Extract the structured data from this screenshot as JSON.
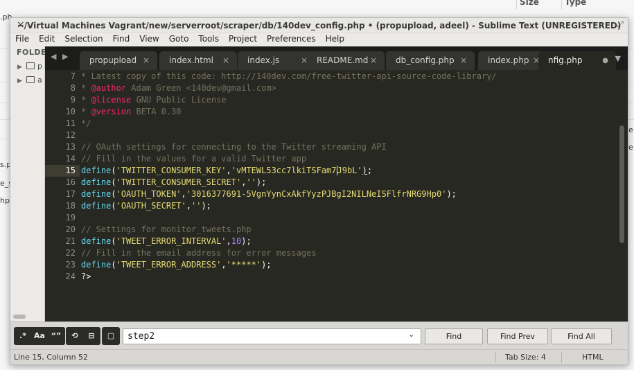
{
  "background": {
    "col_size": "Size",
    "col_type": "Type",
    "left_fragments": [
      "s.p",
      "e_s",
      "hp"
    ],
    "right_fragments": [
      "e",
      "e"
    ],
    "top_fragment": ".ph"
  },
  "window": {
    "close_glyph": "×",
    "title": "~/Virtual Machines Vagrant/new/serverroot/scraper/db/140dev_config.php • (propupload, adeel) - Sublime Text (UNREGISTERED)",
    "maximize_glyph": "⤢"
  },
  "menu": [
    "File",
    "Edit",
    "Selection",
    "Find",
    "View",
    "Goto",
    "Tools",
    "Project",
    "Preferences",
    "Help"
  ],
  "sidebar": {
    "header": "FOLDE",
    "items": [
      {
        "name": "p"
      },
      {
        "name": "a"
      }
    ]
  },
  "tabs": [
    {
      "label": "propupload",
      "close": "×"
    },
    {
      "label": "index.html",
      "close": "×"
    },
    {
      "label": "index.js",
      "close": "×"
    },
    {
      "label": "README.md",
      "close": "×"
    },
    {
      "label": "db_config.php",
      "close": "×"
    },
    {
      "label": "index.php",
      "close": "×"
    },
    {
      "label": "nfig.php",
      "close": "●",
      "active": true
    }
  ],
  "editor": {
    "current_line": 15,
    "line_numbers": [
      "7",
      "8",
      "9",
      "10",
      "11",
      "12",
      "13",
      "14",
      "15",
      "16",
      "17",
      "18",
      "19",
      "20",
      "21",
      "22",
      "23",
      "24"
    ],
    "lines": [
      [
        {
          "t": "* Latest copy of this code: http://140dev.com/free-twitter-api-source-code-library/",
          "c": "comment"
        }
      ],
      [
        {
          "t": "* ",
          "c": "comment"
        },
        {
          "t": "@author",
          "c": "at"
        },
        {
          "t": " Adam Green <140dev@gmail.com>",
          "c": "comment"
        }
      ],
      [
        {
          "t": "* ",
          "c": "comment"
        },
        {
          "t": "@license",
          "c": "at"
        },
        {
          "t": " GNU Public License",
          "c": "comment"
        }
      ],
      [
        {
          "t": "* ",
          "c": "comment"
        },
        {
          "t": "@version",
          "c": "at"
        },
        {
          "t": " BETA 0.30",
          "c": "comment"
        }
      ],
      [
        {
          "t": "*/",
          "c": "comment"
        }
      ],
      [],
      [
        {
          "t": "// OAuth settings for connecting to the Twitter streaming API",
          "c": "comment"
        }
      ],
      [
        {
          "t": "// Fill in the values for a valid Twitter app",
          "c": "comment"
        }
      ],
      [
        {
          "t": "define",
          "c": "func"
        },
        {
          "t": "(",
          "c": "plain"
        },
        {
          "t": "'TWITTER_CONSUMER_KEY'",
          "c": "str"
        },
        {
          "t": ",",
          "c": "plain"
        },
        {
          "t": "'vMTEWL53cc7lkiTSFam7",
          "c": "str"
        },
        {
          "t": "",
          "c": "cursor"
        },
        {
          "t": "J9bL'",
          "c": "str"
        },
        {
          "t": ")",
          "c": "plain underline"
        },
        {
          "t": ";",
          "c": "plain"
        }
      ],
      [
        {
          "t": "define",
          "c": "func"
        },
        {
          "t": "(",
          "c": "plain"
        },
        {
          "t": "'TWITTER_CONSUMER_SECRET'",
          "c": "str"
        },
        {
          "t": ",",
          "c": "plain"
        },
        {
          "t": "''",
          "c": "str"
        },
        {
          "t": ");",
          "c": "plain"
        }
      ],
      [
        {
          "t": "define",
          "c": "func"
        },
        {
          "t": "(",
          "c": "plain"
        },
        {
          "t": "'OAUTH_TOKEN'",
          "c": "str"
        },
        {
          "t": ",",
          "c": "plain"
        },
        {
          "t": "'3016377691-5VgnYynCxAkfYyzPJBgI2NILNeISFlfrNRG9Hp0'",
          "c": "str"
        },
        {
          "t": ");",
          "c": "plain"
        }
      ],
      [
        {
          "t": "define",
          "c": "func"
        },
        {
          "t": "(",
          "c": "plain"
        },
        {
          "t": "'OAUTH_SECRET'",
          "c": "str"
        },
        {
          "t": ",",
          "c": "plain"
        },
        {
          "t": "''",
          "c": "str"
        },
        {
          "t": ");",
          "c": "plain"
        }
      ],
      [],
      [
        {
          "t": "// Settings for monitor_tweets.php",
          "c": "comment"
        }
      ],
      [
        {
          "t": "define",
          "c": "func"
        },
        {
          "t": "(",
          "c": "plain"
        },
        {
          "t": "'TWEET_ERROR_INTERVAL'",
          "c": "str"
        },
        {
          "t": ",",
          "c": "plain"
        },
        {
          "t": "10",
          "c": "num"
        },
        {
          "t": ");",
          "c": "plain"
        }
      ],
      [
        {
          "t": "// Fill in the email address for error messages",
          "c": "comment"
        }
      ],
      [
        {
          "t": "define",
          "c": "func"
        },
        {
          "t": "(",
          "c": "plain"
        },
        {
          "t": "'TWEET_ERROR_ADDRESS'",
          "c": "str"
        },
        {
          "t": ",",
          "c": "plain"
        },
        {
          "t": "'*****'",
          "c": "str"
        },
        {
          "t": ");",
          "c": "plain"
        }
      ],
      [
        {
          "t": "?>",
          "c": "plain"
        }
      ]
    ]
  },
  "find": {
    "regex_label": ".*",
    "case_label": "Aa",
    "word_label": "“”",
    "wrap_label": "⟲",
    "in_selection_label": "⊟",
    "highlight_label": "▢",
    "value": "step2",
    "dropdown_glyph": "⌄",
    "find_label": "Find",
    "find_prev_label": "Find Prev",
    "find_all_label": "Find All"
  },
  "status": {
    "position": "Line 15, Column 52",
    "tab_size": "Tab Size: 4",
    "syntax": "HTML"
  },
  "colors": {
    "editor_bg": "#272822",
    "comment": "#75715e",
    "keyword_at": "#f92672",
    "function": "#66d9ef",
    "string": "#e6db74",
    "number": "#ae81ff"
  }
}
